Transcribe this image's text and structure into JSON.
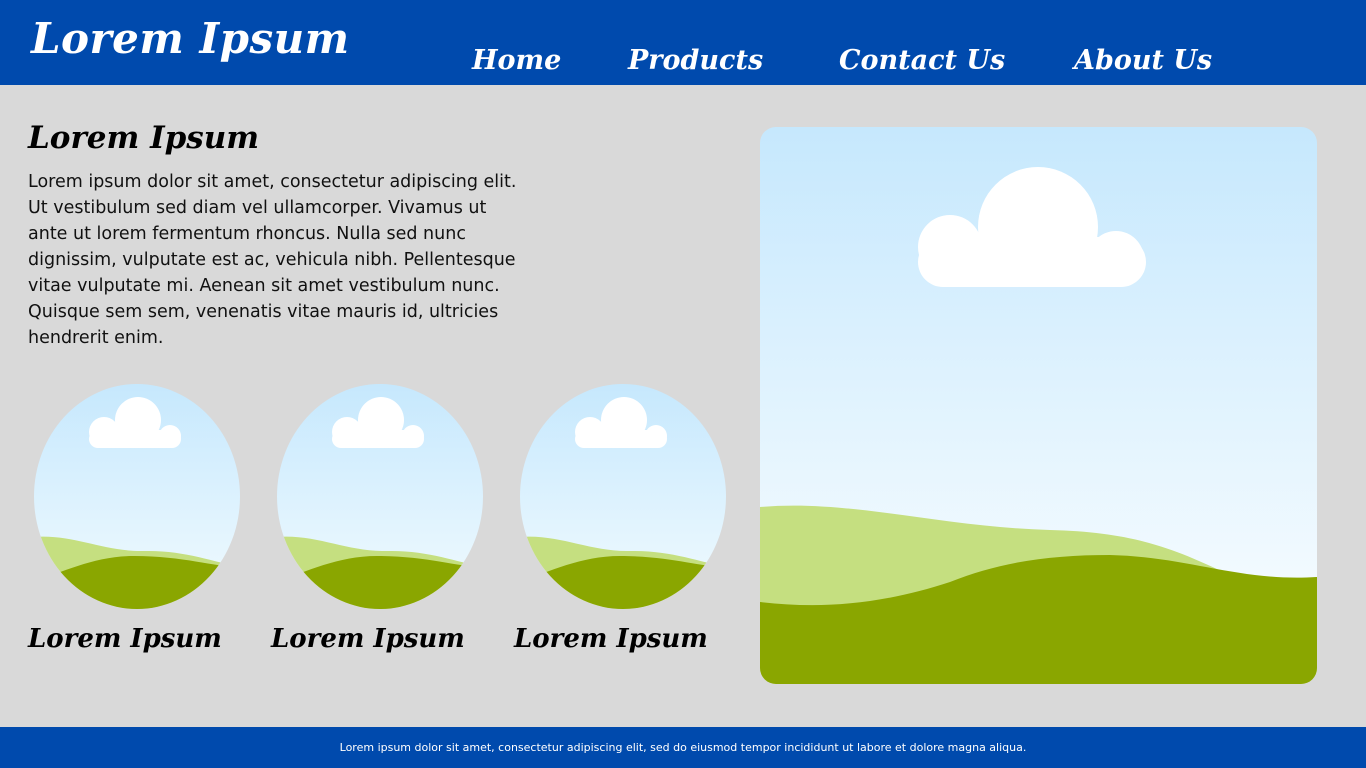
{
  "header": {
    "logo": "Lorem Ipsum",
    "nav": [
      "Home",
      "Products",
      "Contact Us",
      "About Us"
    ]
  },
  "intro": {
    "title": "Lorem Ipsum",
    "text": "Lorem ipsum dolor sit amet, consectetur adipiscing elit. Ut vestibulum sed diam vel ullamcorper. Vivamus ut ante ut lorem fermentum rhoncus. Nulla sed nunc dignissim, vulputate est ac, vehicula nibh. Pellentesque vitae vulputate mi. Aenean sit amet vestibulum nunc. Quisque sem sem, venenatis vitae mauris id, ultricies hendrerit enim."
  },
  "gallery": [
    {
      "caption": "Lorem Ipsum",
      "icon": "landscape-image"
    },
    {
      "caption": "Lorem Ipsum",
      "icon": "landscape-image"
    },
    {
      "caption": "Lorem Ipsum",
      "icon": "landscape-image"
    }
  ],
  "hero": {
    "icon": "landscape-image"
  },
  "footer": {
    "text": "Lorem ipsum dolor sit amet, consectetur adipiscing elit, sed do eiusmod tempor incididunt ut labore et dolore magna aliqua."
  },
  "colors": {
    "brand_blue": "#004aad",
    "page_background": "#d9d9d9",
    "sky_top": "#c6e8fd",
    "sky_bottom": "#f2fbff",
    "hill_light": "#c5df80",
    "hill_dark": "#8aa600",
    "cloud": "#ffffff"
  }
}
